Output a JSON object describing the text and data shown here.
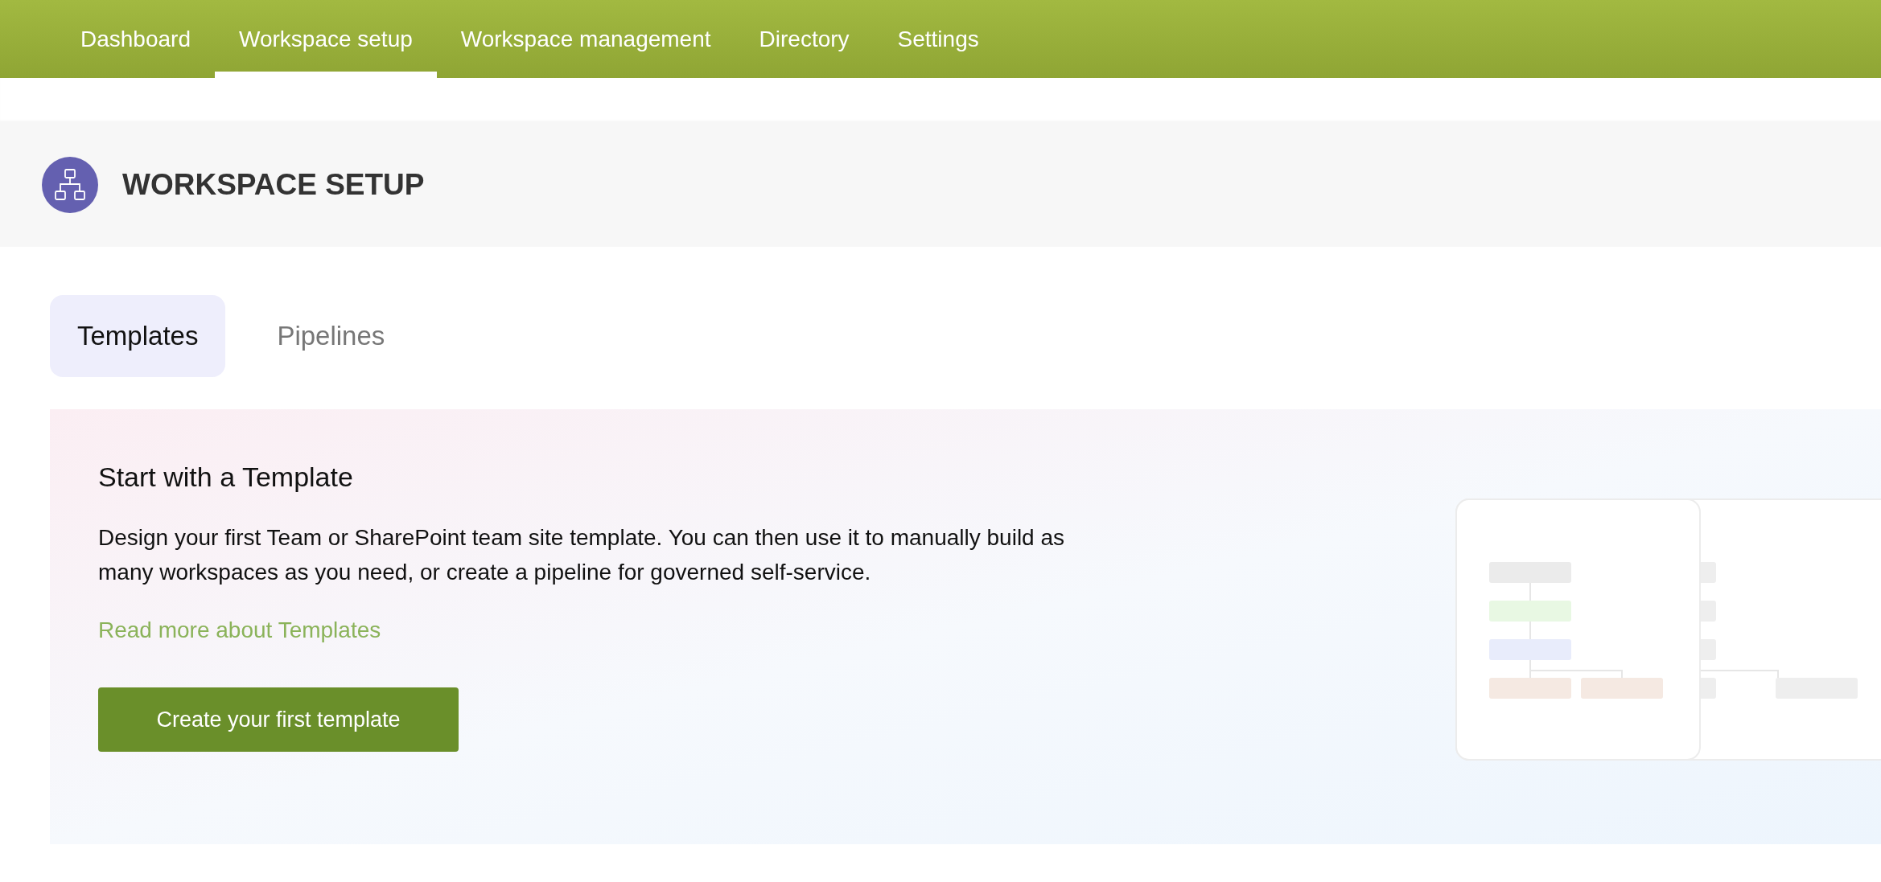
{
  "nav": [
    {
      "label": "Dashboard",
      "selected": false
    },
    {
      "label": "Workspace setup",
      "selected": true
    },
    {
      "label": "Workspace management",
      "selected": false
    },
    {
      "label": "Directory",
      "selected": false
    },
    {
      "label": "Settings",
      "selected": false
    }
  ],
  "page_header": {
    "title": "WORKSPACE SETUP"
  },
  "tabs": [
    {
      "label": "Templates",
      "selected": true
    },
    {
      "label": "Pipelines",
      "selected": false
    }
  ],
  "empty_state": {
    "title": "Start with a Template",
    "description": "Design your first Team or SharePoint team site template. You can then use it to manually build as many workspaces as you need, or create a pipeline for governed self-service.",
    "link": "Read more about Templates",
    "button": "Create your first template"
  }
}
